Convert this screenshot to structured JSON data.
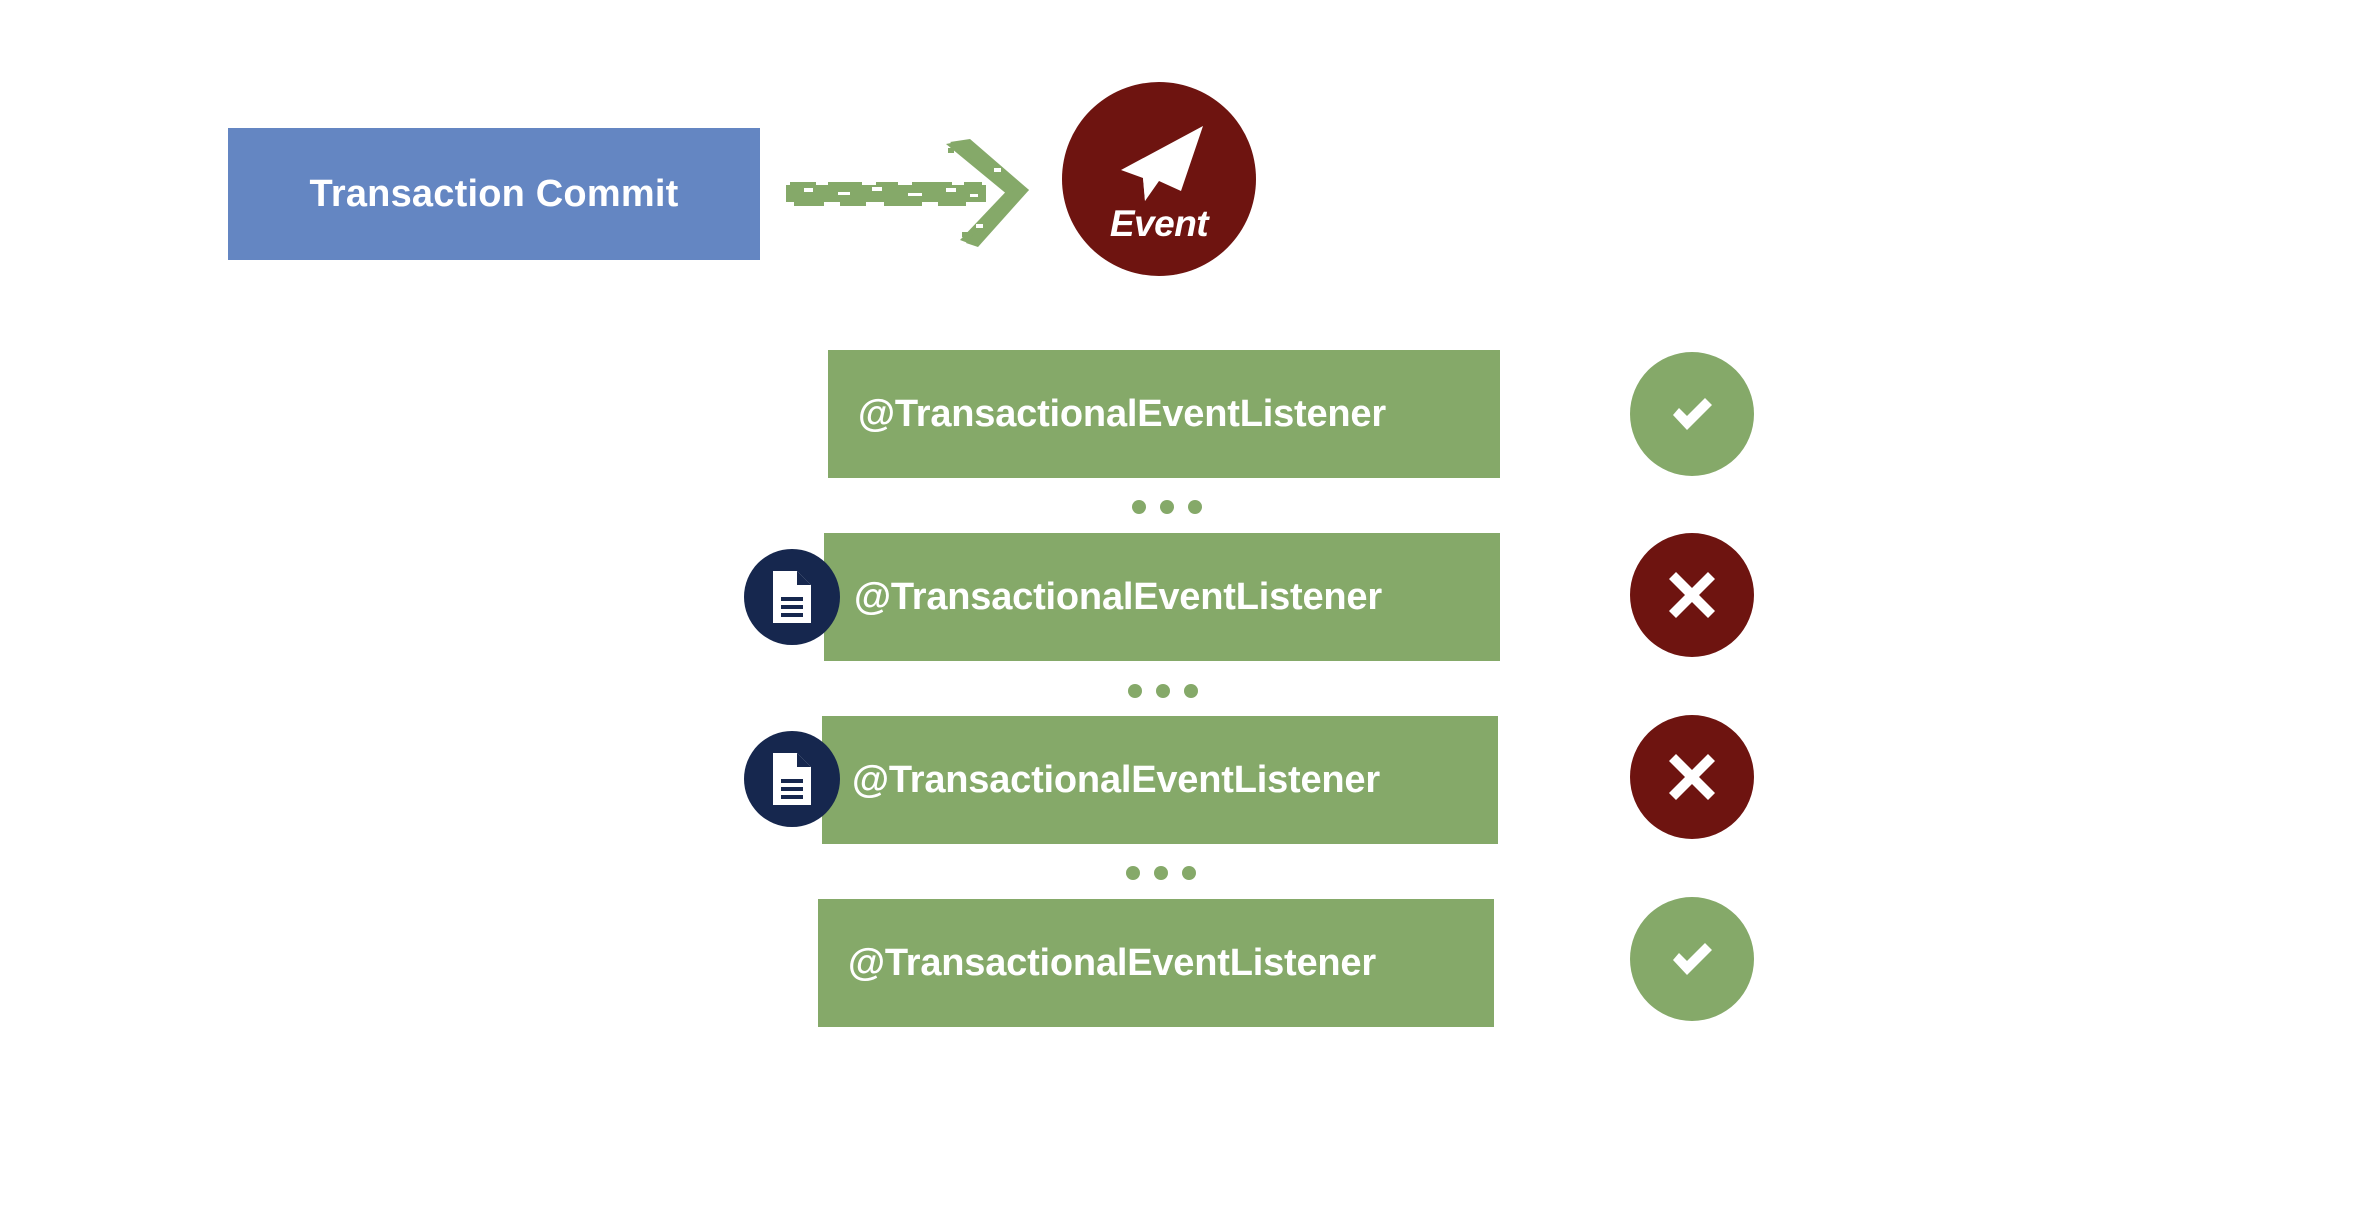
{
  "diagram": {
    "title_text": "Transaction Commit",
    "event": {
      "label": "Event",
      "icon": "paper-plane-icon",
      "color": "#6E1410"
    },
    "arrow": {
      "icon": "arrow-right-icon",
      "color": "#85A969"
    },
    "colors": {
      "commit_box": "#6486C2",
      "listener_bar": "#85A969",
      "doc_badge": "#16274E",
      "status_ok": "#85A969",
      "status_fail": "#6E1410",
      "text_on_fill": "#FFFFFF",
      "background": "#FFFFFF"
    },
    "listeners": [
      {
        "label": "@TransactionalEventListener",
        "status": "ok",
        "status_icon": "check-icon",
        "has_doc_badge": false
      },
      {
        "label": "@TransactionalEventListener",
        "status": "fail",
        "status_icon": "cross-icon",
        "has_doc_badge": true,
        "doc_icon": "document-icon"
      },
      {
        "label": "@TransactionalEventListener",
        "status": "fail",
        "status_icon": "cross-icon",
        "has_doc_badge": true,
        "doc_icon": "document-icon"
      },
      {
        "label": "@TransactionalEventListener",
        "status": "ok",
        "status_icon": "check-icon",
        "has_doc_badge": false
      }
    ],
    "separators": [
      {
        "glyph": "three-dots"
      },
      {
        "glyph": "three-dots"
      },
      {
        "glyph": "three-dots"
      }
    ]
  }
}
